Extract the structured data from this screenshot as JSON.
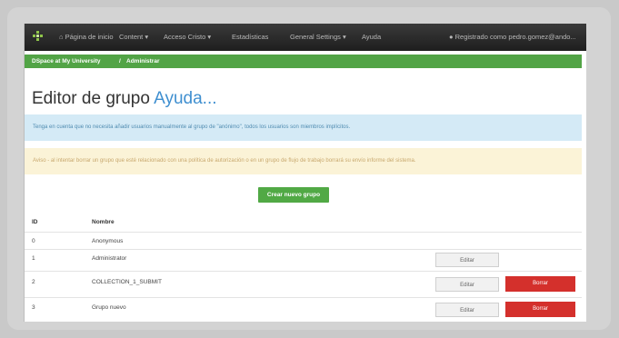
{
  "nav": {
    "home": "Página de inicio",
    "content": "Content",
    "access": "Acceso Cristo",
    "stats": "Estadísticas",
    "settings": "General Settings",
    "help": "Ayuda",
    "user": "Registrado como pedro.gomez@ando..."
  },
  "breadcrumb": {
    "root": "DSpace at My University",
    "separator": "/",
    "current": "Administrar"
  },
  "page": {
    "title": "Editor de grupo",
    "title_accent": "Ayuda..."
  },
  "alerts": {
    "info": "Tenga en cuenta que no necesita añadir usuarios manualmente al grupo de \"anónimo\", todos los usuarios son miembros implícitos.",
    "warning": "Aviso - al intentar borrar un grupo que esté relacionado con una política de autorización o en un grupo de flujo de trabajo borrará su envío informe del sistema."
  },
  "create_button": "Crear nuevo grupo",
  "table": {
    "headers": [
      "ID",
      "Nombre"
    ],
    "rows": [
      {
        "id": "0",
        "name": "Anonymous"
      },
      {
        "id": "1",
        "name": "Administrator",
        "edit": "Editar"
      },
      {
        "id": "2",
        "name": "COLLECTION_1_SUBMIT",
        "edit": "Editar",
        "delete": "Borrar"
      },
      {
        "id": "3",
        "name": "Grupo nuevo",
        "edit": "Editar",
        "delete": "Borrar"
      }
    ]
  },
  "icons": {
    "logo": "dspace-logo-icon",
    "home": "home-icon",
    "user": "user-icon",
    "dropdown": "caret-down-icon"
  },
  "colors": {
    "navbar": "#2a2a2a",
    "breadcrumb": "#52a446",
    "accent": "#3f8fd0",
    "info_bg": "#d4eaf6",
    "warning_bg": "#fbf3d7",
    "primary_button": "#51a945",
    "danger_button": "#d4302c"
  }
}
